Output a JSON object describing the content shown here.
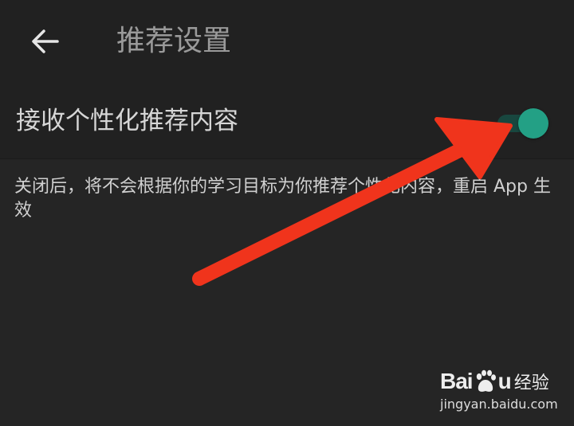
{
  "header": {
    "back_icon": "arrow-left-icon",
    "title": "推荐设置"
  },
  "setting": {
    "label": "接收个性化推荐内容",
    "toggle_state": "on",
    "accent_color": "#23a085",
    "track_color": "#18473f"
  },
  "description": "关闭后，将不会根据你的学习目标为你推荐个性化内容，重启 App 生效",
  "annotation": {
    "arrow_color": "#f0341c"
  },
  "watermark": {
    "logo_text_a": "Bai",
    "logo_text_b": "u",
    "cn_text": "经验",
    "url": "jingyan.baidu.com"
  }
}
